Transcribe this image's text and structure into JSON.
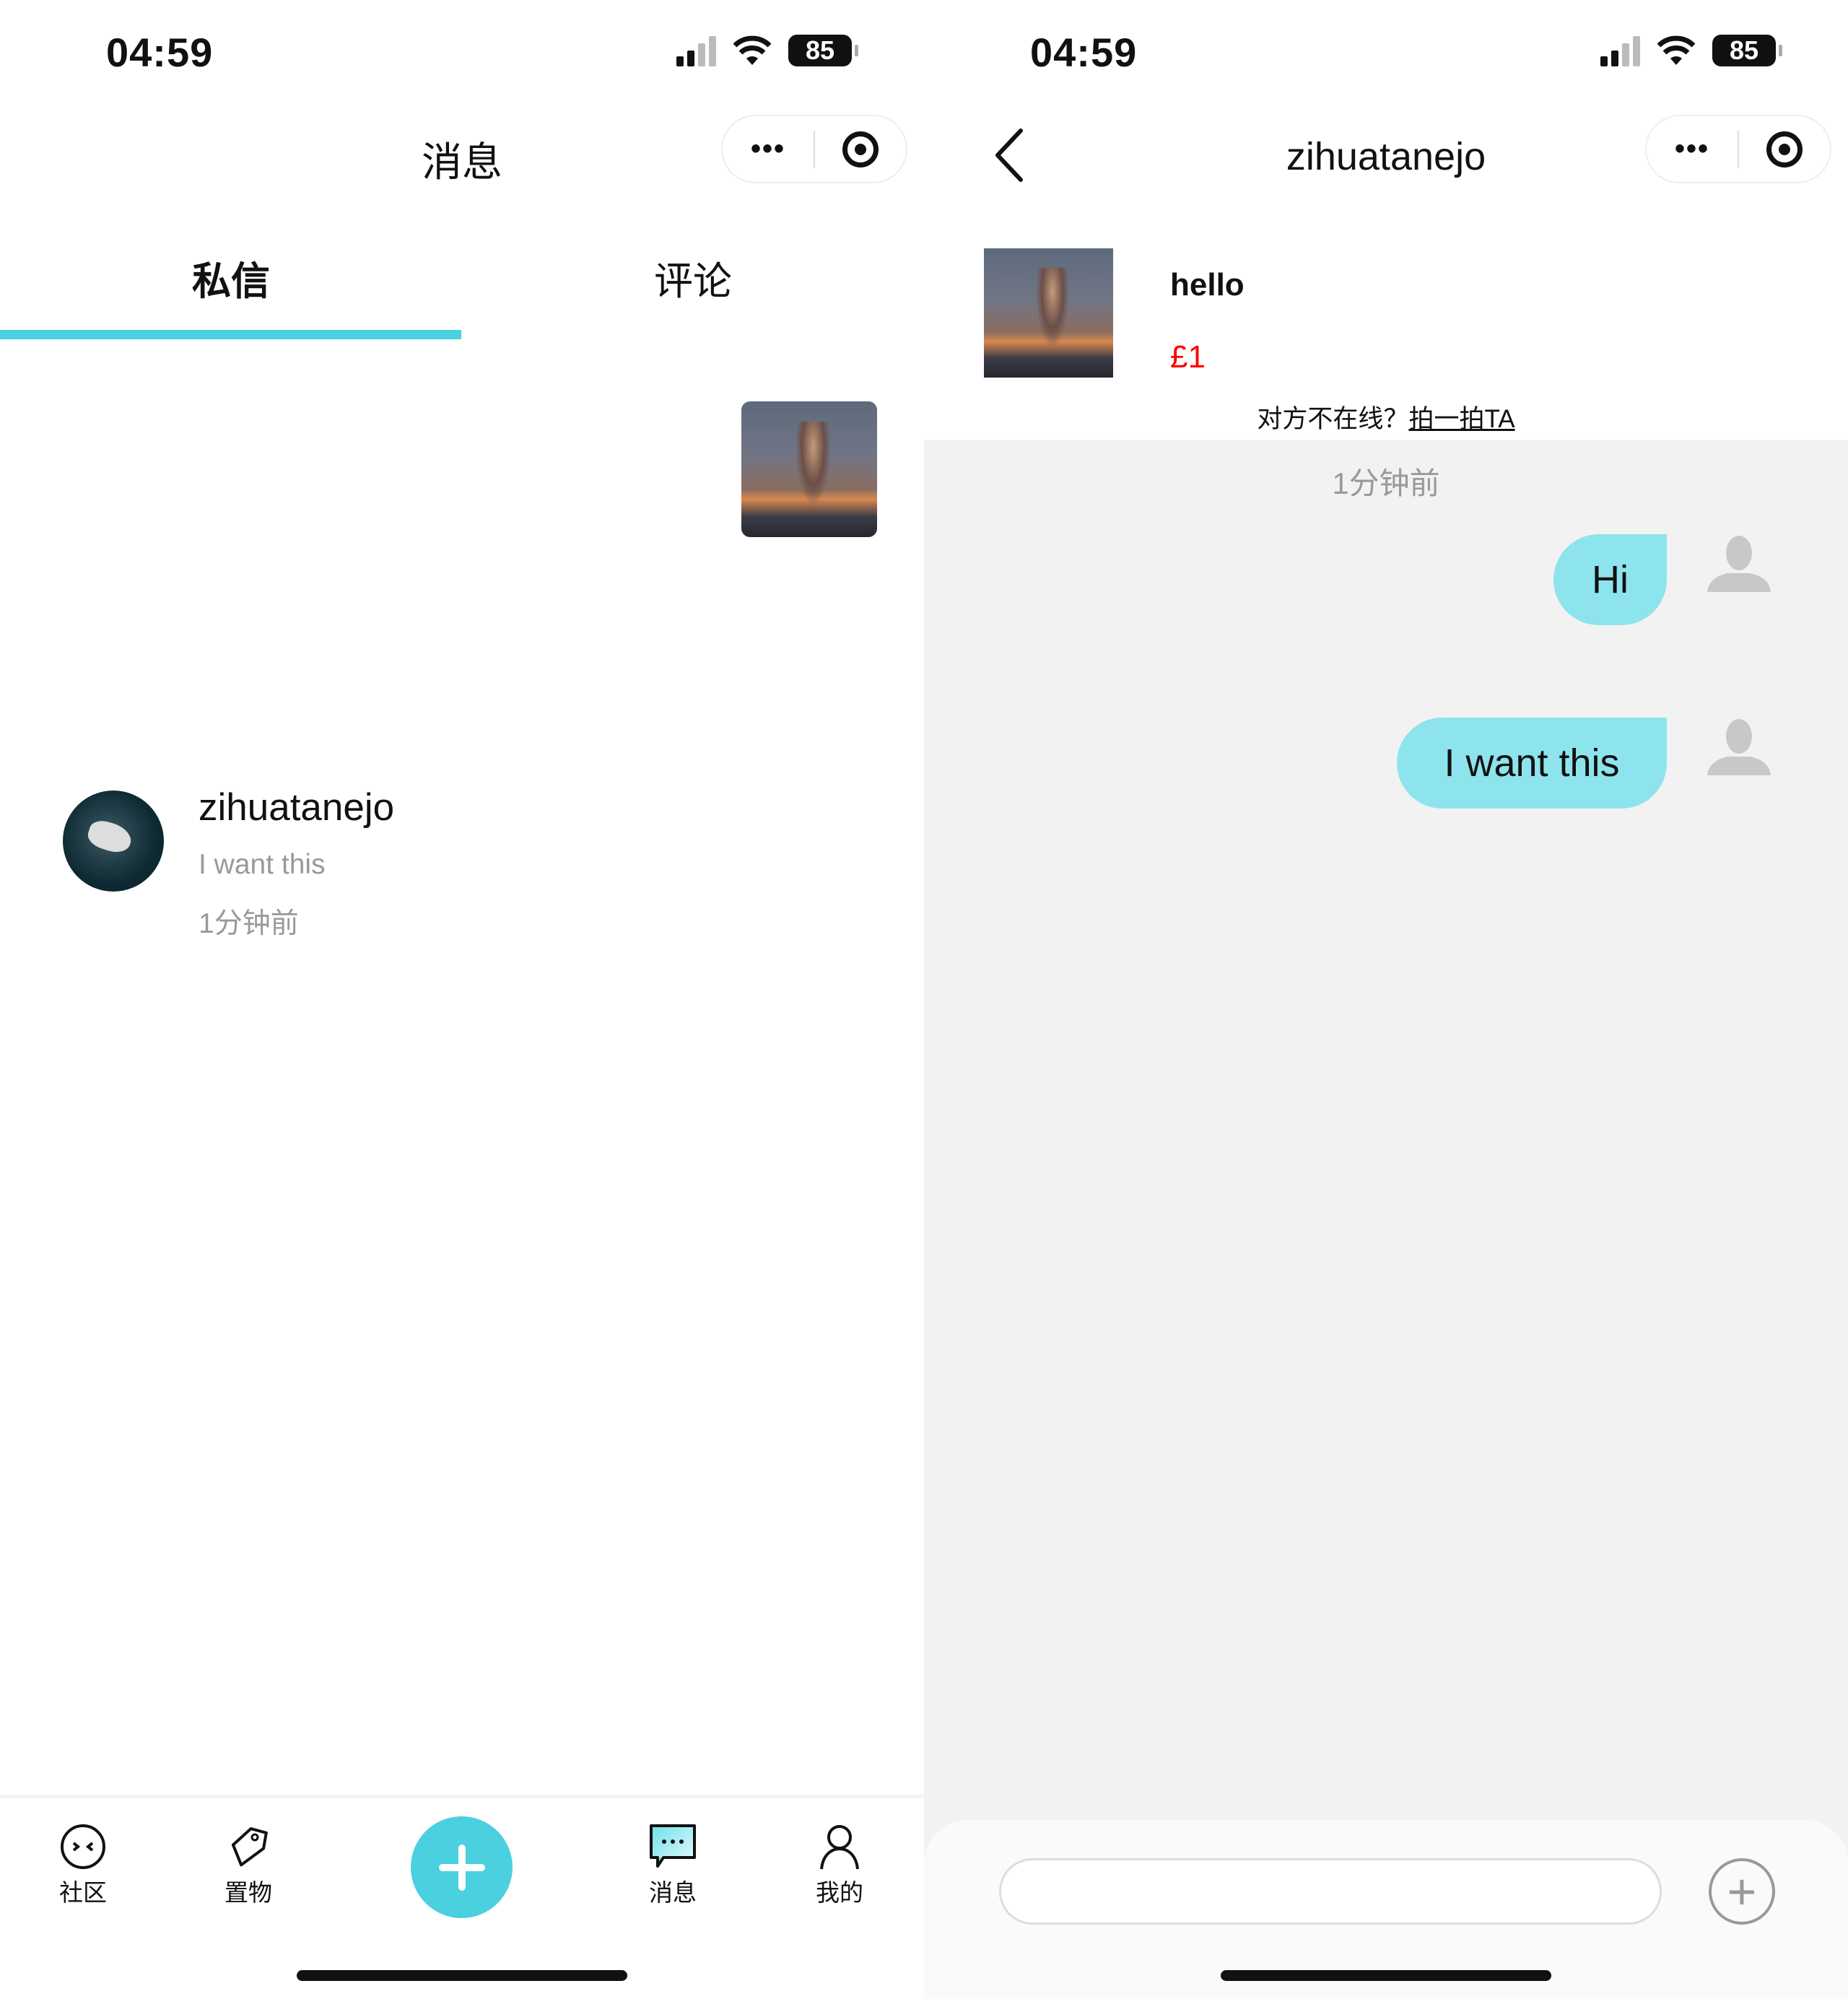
{
  "status_bar": {
    "time": "04:59",
    "battery": "85"
  },
  "left": {
    "nav_title": "消息",
    "capsule": {
      "more": "•••"
    },
    "tabs": [
      {
        "label": "私信",
        "active": true
      },
      {
        "label": "评论",
        "active": false
      }
    ],
    "conversations": [
      {
        "name": "zihuatanejo",
        "preview": "I want this",
        "time": "1分钟前"
      }
    ],
    "bottom_nav": [
      {
        "label": "社区",
        "icon": "community-face-icon"
      },
      {
        "label": "置物",
        "icon": "tag-icon"
      },
      {
        "label": "消息",
        "icon": "chat-bubble-icon",
        "active": true
      },
      {
        "label": "我的",
        "icon": "person-icon"
      }
    ]
  },
  "right": {
    "nav_title": "zihuatanejo",
    "capsule": {
      "more": "•••"
    },
    "product": {
      "title": "hello",
      "price": "£1"
    },
    "offline_prompt": "对方不在线？",
    "nudge_link": "拍一拍TA",
    "timestamp": "1分钟前",
    "messages": [
      {
        "text": "Hi",
        "from": "me"
      },
      {
        "text": "I want this",
        "from": "me"
      }
    ],
    "input_placeholder": ""
  },
  "colors": {
    "accent": "#4ad0df",
    "bubble": "#8ee4ec",
    "price": "#ff0000",
    "chat_bg": "#f2f2f2"
  }
}
